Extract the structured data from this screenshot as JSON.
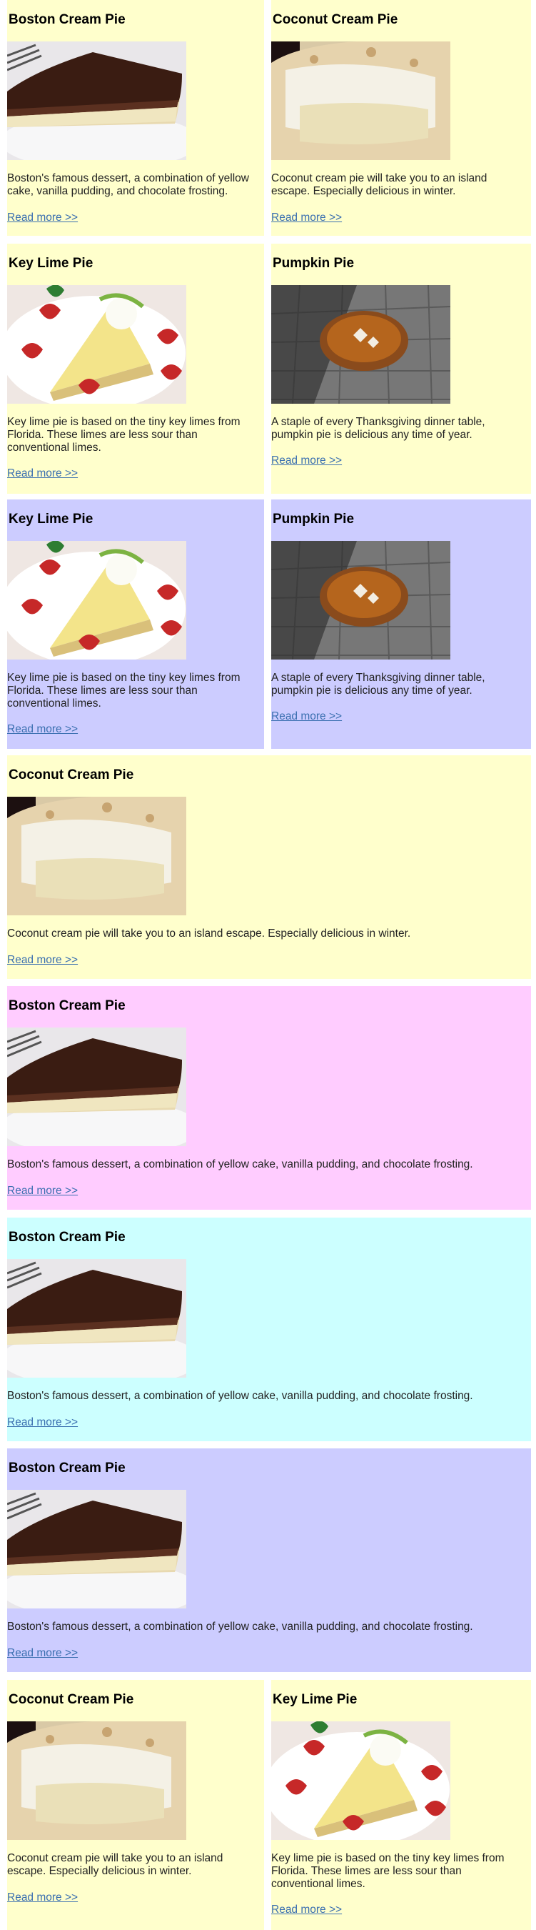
{
  "read_more": "Read more >>",
  "pies": {
    "boston": {
      "title": "Boston Cream Pie",
      "desc": "Boston's famous dessert, a combination of yellow cake, vanilla pudding, and chocolate frosting."
    },
    "coconut": {
      "title": "Coconut Cream Pie",
      "desc": "Coconut cream pie will take you to an island escape. Especially delicious in winter."
    },
    "keylime": {
      "title": "Key Lime Pie",
      "desc": "Key lime pie is based on the tiny key limes from Florida. These limes are less sour than conventional limes."
    },
    "pumpkin": {
      "title": "Pumpkin Pie",
      "desc": "A staple of every Thanksgiving dinner table, pumpkin pie is delicious any time of year."
    }
  },
  "colors": {
    "yellow": "#ffffcc",
    "blue": "#ccccff",
    "pink": "#ffccff",
    "cyan": "#ccffff",
    "link": "#3a6fb0"
  }
}
